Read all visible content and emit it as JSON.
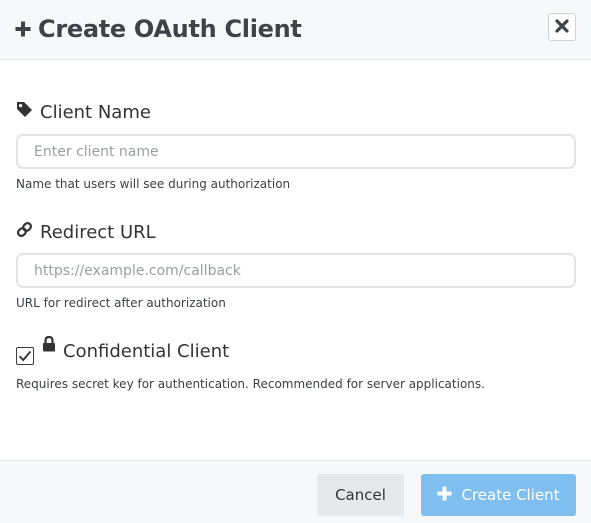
{
  "header": {
    "title": "Create OAuth Client",
    "title_icon": "plus-icon",
    "close_icon": "close-icon"
  },
  "fields": {
    "client_name": {
      "icon": "tag-icon",
      "label": "Client Name",
      "value": "",
      "placeholder": "Enter client name",
      "help": "Name that users will see during authorization"
    },
    "redirect_url": {
      "icon": "link-icon",
      "label": "Redirect URL",
      "value": "",
      "placeholder": "https://example.com/callback",
      "help": "URL for redirect after authorization"
    },
    "confidential": {
      "icon": "lock-icon",
      "label": "Confidential Client",
      "checked": true,
      "help": "Requires secret key for authentication. Recommended for server applications."
    }
  },
  "footer": {
    "cancel_label": "Cancel",
    "create_label": "Create Client",
    "create_icon": "plus-icon"
  },
  "colors": {
    "primary_button": "#7fbfef",
    "header_background": "#f7f8fa",
    "input_border": "#e1e3e6"
  }
}
